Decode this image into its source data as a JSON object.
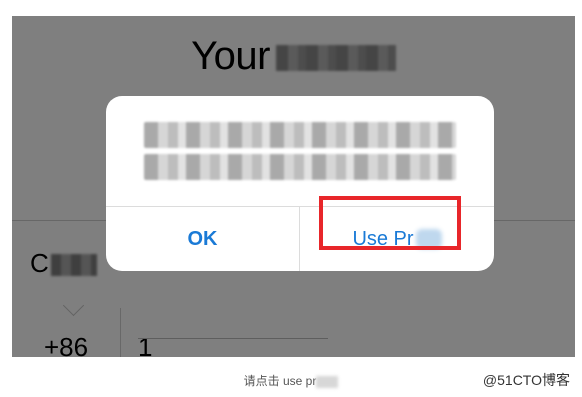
{
  "background": {
    "title": "Your",
    "country_label": "C",
    "country_code": "+86",
    "phone_value": "1"
  },
  "alert": {
    "ok_label": "OK",
    "use_label": "Use Pr"
  },
  "caption": "请点击 use pr",
  "watermark": "@51CTO博客",
  "colors": {
    "accent": "#1a7ad6",
    "highlight": "#e8262a",
    "overlay": "rgba(0,0,0,0.50)"
  }
}
